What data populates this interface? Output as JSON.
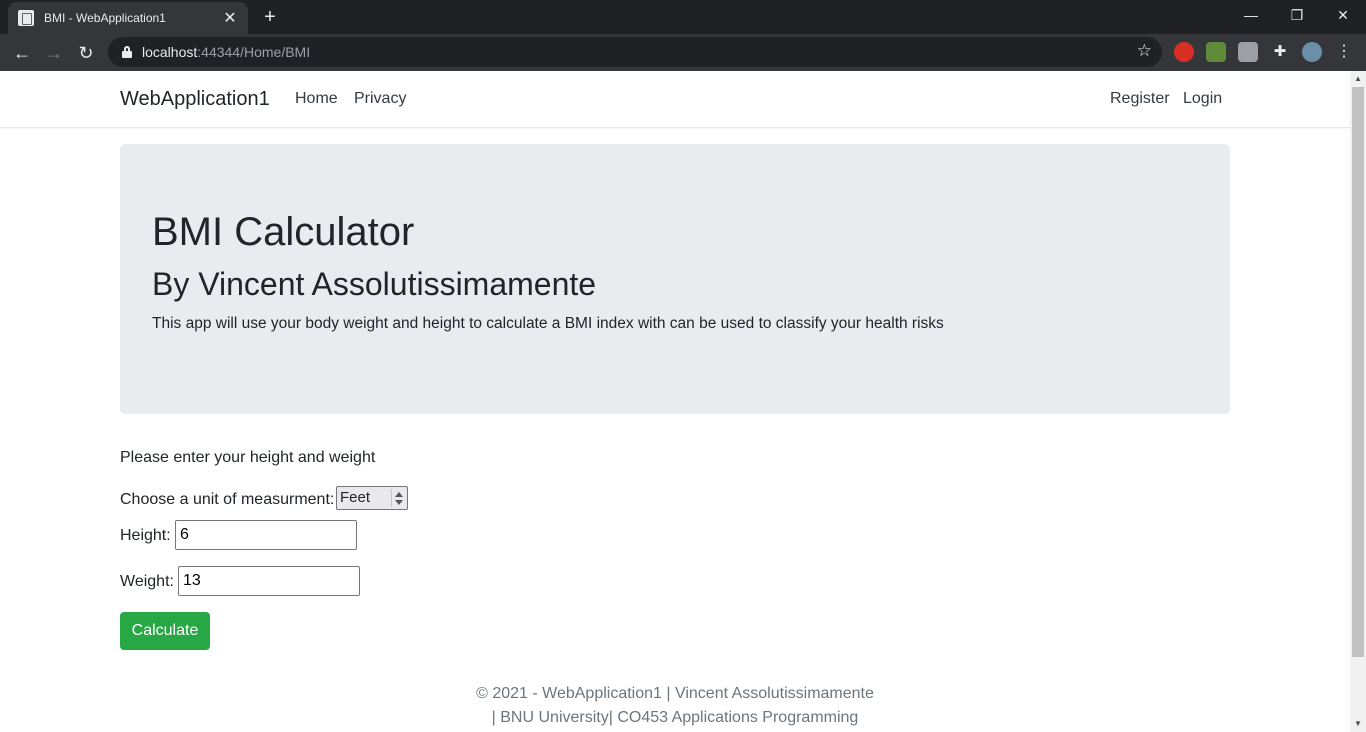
{
  "browser": {
    "tab_title": "BMI - WebApplication1",
    "tab_close": "✕",
    "new_tab": "+",
    "url_host": "localhost",
    "url_rest": ":44344/Home/BMI",
    "window_controls": {
      "minimize": "—",
      "restore": "❐",
      "close": "✕"
    },
    "nav": {
      "back": "←",
      "forward": "→",
      "reload": "↻"
    },
    "star": "☆",
    "menu": "⋮"
  },
  "navbar": {
    "brand": "WebApplication1",
    "links": [
      "Home",
      "Privacy"
    ],
    "right_links": [
      "Register",
      "Login"
    ]
  },
  "jumbotron": {
    "title": "BMI Calculator",
    "subtitle": "By Vincent Assolutissimamente",
    "description": "This app will use your body weight and height to calculate a BMI index with can be used to classify your health risks"
  },
  "form": {
    "prompt": "Please enter your height and weight",
    "unit_label": "Choose a unit of measurment:",
    "unit_value": "Feet",
    "height_label": "Height:",
    "height_value": "6",
    "weight_label": "Weight:",
    "weight_value": "13",
    "submit_label": "Calculate"
  },
  "footer": {
    "line1": "© 2021 - WebApplication1 | Vincent Assolutissimamente",
    "line2": "| BNU University| CO453 Applications Programming"
  },
  "colors": {
    "accent_green": "#28a745",
    "jumbotron_bg": "#e9ecef",
    "chrome_dark": "#202124"
  }
}
